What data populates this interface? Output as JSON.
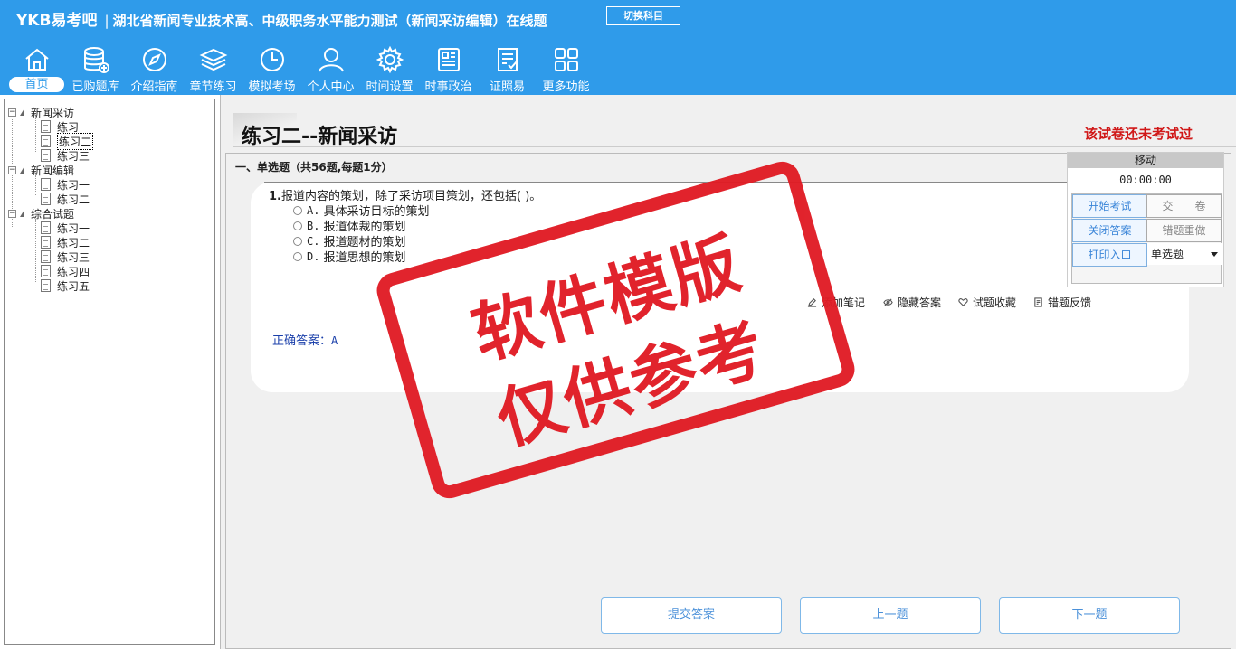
{
  "header": {
    "brand": "YKB易考吧",
    "title": "湖北省新闻专业技术高、中级职务水平能力测试（新闻采访编辑）在线题",
    "switch_label": "切换科目"
  },
  "nav": {
    "items": [
      {
        "label": "首页",
        "icon": "home-icon"
      },
      {
        "label": "已购题库",
        "icon": "database-icon"
      },
      {
        "label": "介绍指南",
        "icon": "compass-icon"
      },
      {
        "label": "章节练习",
        "icon": "layers-icon"
      },
      {
        "label": "模拟考场",
        "icon": "clock-icon"
      },
      {
        "label": "个人中心",
        "icon": "user-icon"
      },
      {
        "label": "时间设置",
        "icon": "gear-icon"
      },
      {
        "label": "时事政治",
        "icon": "news-icon"
      },
      {
        "label": "证照易",
        "icon": "document-check-icon"
      },
      {
        "label": "更多功能",
        "icon": "grid-icon"
      }
    ]
  },
  "tree": {
    "groups": [
      {
        "label": "新闻采访",
        "children": [
          "练习一",
          "练习二",
          "练习三"
        ]
      },
      {
        "label": "新闻编辑",
        "children": [
          "练习一",
          "练习二"
        ]
      },
      {
        "label": "综合试题",
        "children": [
          "练习一",
          "练习二",
          "练习三",
          "练习四",
          "练习五"
        ]
      }
    ]
  },
  "exam": {
    "title": "练习二--新闻采访",
    "status": "该试卷还未考试过",
    "section": "一、单选题（共56题,每题1分）",
    "question_no": "1.",
    "question": "报道内容的策划，除了采访项目策划，还包括( )。",
    "options": [
      {
        "letter": "A.",
        "text": "具体采访目标的策划"
      },
      {
        "letter": "B.",
        "text": "报道体裁的策划"
      },
      {
        "letter": "C.",
        "text": "报道题材的策划"
      },
      {
        "letter": "D.",
        "text": "报道思想的策划"
      }
    ],
    "tools": [
      {
        "label": "添加笔记",
        "icon": "pencil-icon"
      },
      {
        "label": "隐藏答案",
        "icon": "eye-off-icon"
      },
      {
        "label": "试题收藏",
        "icon": "heart-icon"
      },
      {
        "label": "错题反馈",
        "icon": "feedback-icon"
      }
    ],
    "answer_label": "正确答案：",
    "answer_value": "A"
  },
  "side": {
    "move_label": "移动",
    "timer": "00:00:00",
    "start": "开始考试",
    "submit": "交　　卷",
    "close_answer": "关闭答案",
    "redo": "错题重做",
    "print": "打印入口",
    "type_select": "单选题"
  },
  "bottom": {
    "submit_answer": "提交答案",
    "prev": "上一题",
    "next": "下一题"
  },
  "watermark": {
    "line1": "软件模版",
    "line2": "仅供参考"
  },
  "colors": {
    "topbar": "#2f9bea",
    "stamp": "#e01b24",
    "status": "#d01818",
    "answer": "#1a3faa"
  }
}
